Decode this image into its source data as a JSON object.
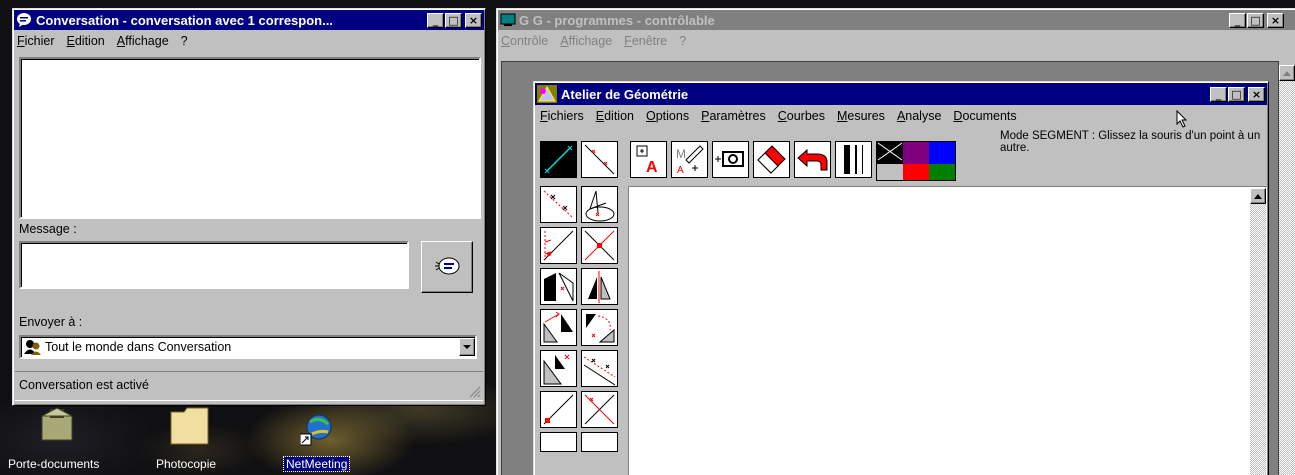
{
  "conversation": {
    "title": "Conversation - conversation avec 1 correspon...",
    "menu": [
      "Fichier",
      "Edition",
      "Affichage",
      "?"
    ],
    "message_label": "Message :",
    "send_to_label": "Envoyer à :",
    "recipient": "Tout le monde dans Conversation",
    "status": "Conversation est activé"
  },
  "desktop_icons": [
    {
      "label": "Porte-documents",
      "icon": "briefcase-icon"
    },
    {
      "label": "Photocopie",
      "icon": "folder-icon"
    },
    {
      "label": "NetMeeting",
      "icon": "netmeeting-icon"
    }
  ],
  "gg": {
    "title": "G G - programmes - contrôlable",
    "menu": [
      "Contrôle",
      "Affichage",
      "Fenêtre",
      "?"
    ]
  },
  "atelier": {
    "title": "Atelier de Géométrie",
    "menu": [
      "Fichiers",
      "Edition",
      "Options",
      "Paramètres",
      "Courbes",
      "Mesures",
      "Analyse",
      "Documents"
    ],
    "mode_text": "Mode SEGMENT : Glissez la souris d'un point à un autre.",
    "palette": [
      "#000000",
      "#800080",
      "#0000ff",
      "#c0c0c0",
      "#ff0000",
      "#008000"
    ]
  },
  "colors": {
    "active_title": "#000080",
    "inactive_title": "#808080",
    "face": "#c0c0c0"
  }
}
